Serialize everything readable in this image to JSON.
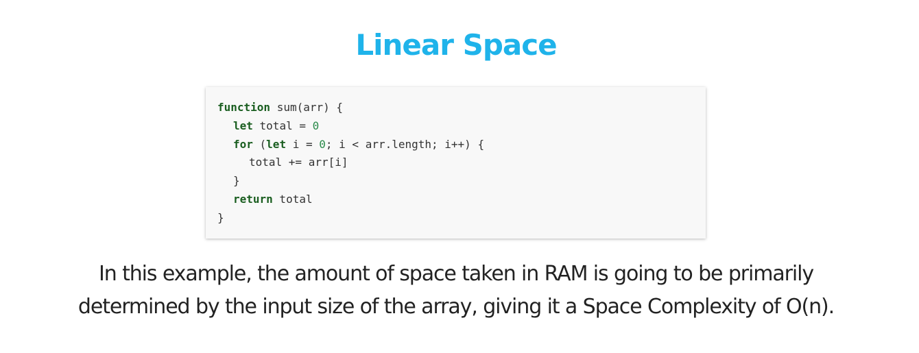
{
  "title": "Linear Space",
  "code": {
    "line1": {
      "kw": "function",
      "rest": " sum(arr) {"
    },
    "line2": {
      "kw": "let",
      "rest1": " total = ",
      "num": "0"
    },
    "line3": {
      "kw1": "for",
      "mid1": " (",
      "kw2": "let",
      "mid2": " i = ",
      "num": "0",
      "rest": "; i < arr.length; i++) {"
    },
    "line4": {
      "text": "total += arr[i]"
    },
    "line5": {
      "text": "}"
    },
    "line6": {
      "kw": "return",
      "rest": " total"
    },
    "line7": {
      "text": "}"
    }
  },
  "description": {
    "line1": "In this example, the amount of space taken in RAM is going to be primarily",
    "line2": "determined by the input size of the array, giving it a Space Complexity of O(n)."
  },
  "colors": {
    "title": "#1fb3ea",
    "keyword": "#1a5e20",
    "number": "#2a8a4a",
    "code_text": "#333333",
    "code_background": "#f8f8f8"
  }
}
